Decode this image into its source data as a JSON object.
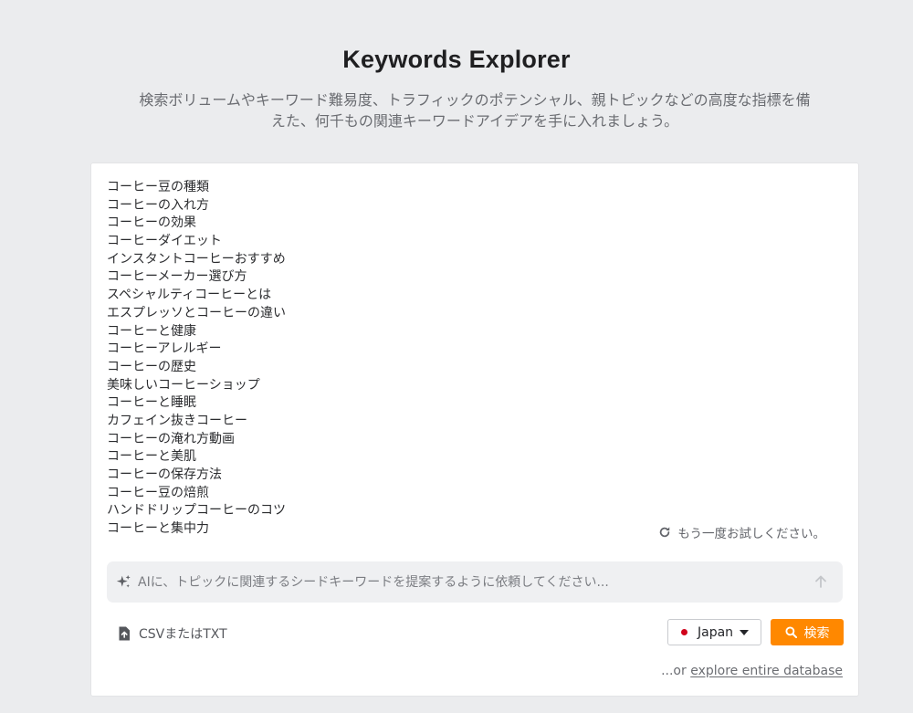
{
  "header": {
    "title": "Keywords Explorer",
    "subtitle_line1": "検索ボリュームやキーワード難易度、トラフィックのポテンシャル、親トピックなどの高度な指標を備",
    "subtitle_line2": "えた、何千もの関連キーワードアイデアを手に入れましょう。"
  },
  "keywords": [
    "コーヒー豆の種類",
    "コーヒーの入れ方",
    "コーヒーの効果",
    "コーヒーダイエット",
    "インスタントコーヒーおすすめ",
    "コーヒーメーカー選び方",
    "スペシャルティコーヒーとは",
    "エスプレッソとコーヒーの違い",
    "コーヒーと健康",
    "コーヒーアレルギー",
    "コーヒーの歴史",
    "美味しいコーヒーショップ",
    "コーヒーと睡眠",
    "カフェイン抜きコーヒー",
    "コーヒーの淹れ方動画",
    "コーヒーと美肌",
    "コーヒーの保存方法",
    "コーヒー豆の焙煎",
    "ハンドドリップコーヒーのコツ",
    "コーヒーと集中力"
  ],
  "retry": {
    "label": "もう一度お試しください。",
    "icon": "refresh-icon"
  },
  "ai_prompt": {
    "value": "",
    "placeholder": "AIに、トピックに関連するシードキーワードを提案するように依頼してください...",
    "icon": "sparkle-icon",
    "send_icon": "arrow-up-icon"
  },
  "upload": {
    "label": "CSVまたはTXT",
    "icon": "upload-file-icon"
  },
  "country": {
    "label": "Japan",
    "flag_color": "#d0021b"
  },
  "search": {
    "label": "検索",
    "icon": "search-icon",
    "color": "#ff8800"
  },
  "explore": {
    "prefix": "...or ",
    "link": "explore entire database"
  }
}
